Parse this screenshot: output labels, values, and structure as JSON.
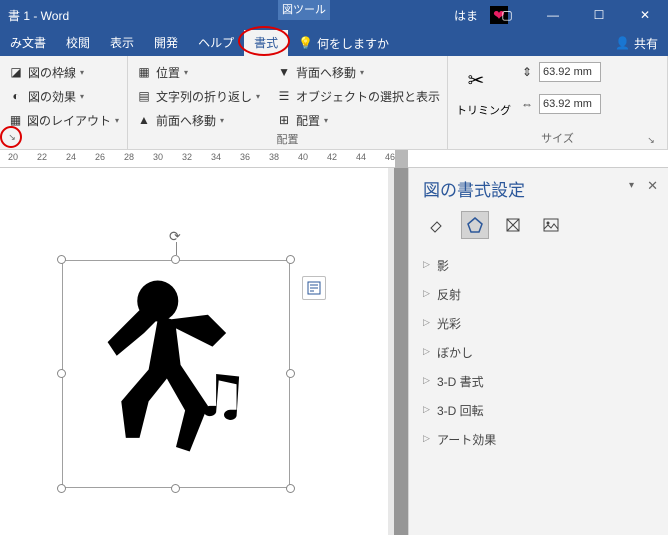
{
  "titlebar": {
    "title": "書 1 - Word",
    "tool_tab": "図ツール",
    "user": "はま"
  },
  "win": {
    "ribbon": "▢",
    "min": "—",
    "max": "☐",
    "close": "✕"
  },
  "menu": {
    "items": [
      "み文書",
      "校閲",
      "表示",
      "開発",
      "ヘルプ",
      "書式"
    ],
    "tell_me": "何をしますか",
    "share": "共有"
  },
  "ribbon": {
    "g1": {
      "frame": "図の枠線",
      "effects": "図の効果",
      "layout": "図のレイアウト"
    },
    "g2": {
      "position": "位置",
      "wrap": "文字列の折り返し",
      "front": "前面へ移動",
      "back": "背面へ移動",
      "select": "オブジェクトの選択と表示",
      "align": "配置",
      "label": "配置"
    },
    "g3": {
      "trim": "トリミング",
      "h": "63.92 mm",
      "w": "63.92 mm",
      "label": "サイズ"
    }
  },
  "ruler": {
    "ticks": [
      "20",
      "22",
      "24",
      "26",
      "28",
      "30",
      "32",
      "34",
      "36",
      "38",
      "40",
      "42",
      "44",
      "46"
    ]
  },
  "pane": {
    "title": "図の書式設定",
    "items": [
      "影",
      "反射",
      "光彩",
      "ぼかし",
      "3-D 書式",
      "3-D 回転",
      "アート効果"
    ]
  }
}
